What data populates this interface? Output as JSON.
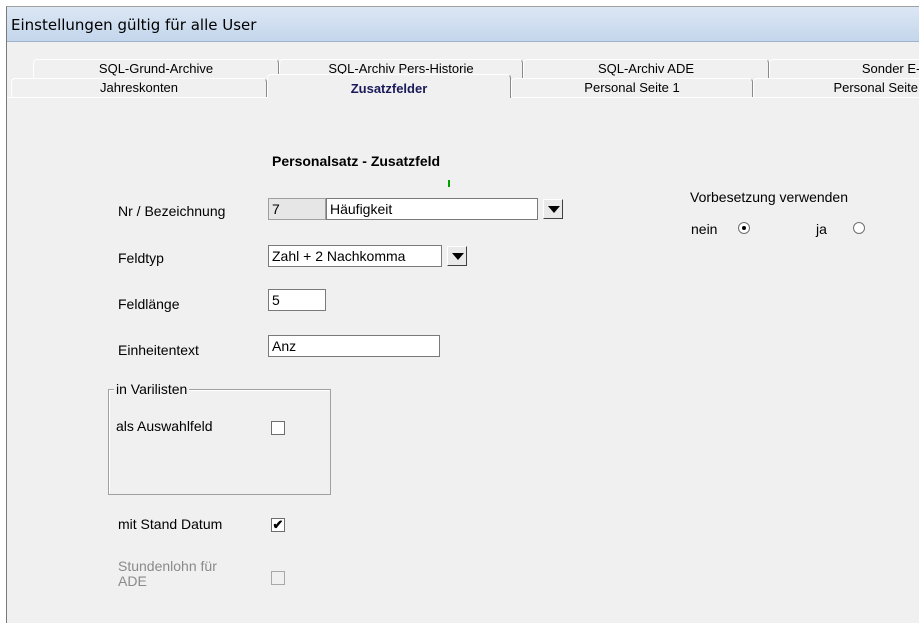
{
  "window": {
    "title": "Einstellungen gültig für alle User"
  },
  "tabs_row1": [
    "SQL-Grund-Archive",
    "SQL-Archiv Pers-Historie",
    "SQL-Archiv ADE",
    "Sonder E-I"
  ],
  "tabs_row2": [
    "Jahreskonten",
    "Zusatzfelder",
    "Personal Seite 1",
    "Personal Seite"
  ],
  "active_tab": "Zusatzfelder",
  "section": {
    "heading": "Personalsatz - Zusatzfeld"
  },
  "fields": {
    "nr_label": "Nr / Bezeichnung",
    "nr_value": "7",
    "bezeichnung_value": "Häufigkeit",
    "feldtyp_label": "Feldtyp",
    "feldtyp_value": "Zahl + 2 Nachkomma",
    "feldlaenge_label": "Feldlänge",
    "feldlaenge_value": "5",
    "einheitentext_label": "Einheitentext",
    "einheitentext_value": "Anz"
  },
  "vorbesetzung": {
    "label": "Vorbesetzung verwenden",
    "nein_label": "nein",
    "ja_label": "ja",
    "selected": "nein"
  },
  "varilisten": {
    "group_title": "in Varilisten",
    "auswahlfeld_label": "als Auswahlfeld",
    "auswahlfeld_checked": false
  },
  "mit_stand_datum": {
    "label": "mit Stand Datum",
    "checked": true,
    "check_glyph": "✔"
  },
  "stundenlohn": {
    "label_line1": "Stundenlohn für",
    "label_line2": "ADE",
    "checked": false,
    "disabled": true
  }
}
